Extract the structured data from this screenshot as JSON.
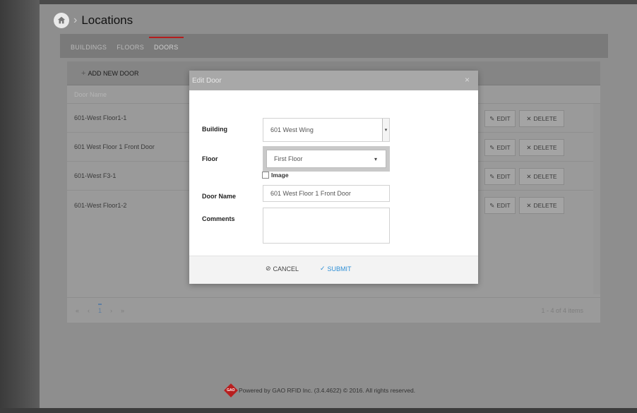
{
  "header": {
    "title": "Locations",
    "breadcrumb_sep": "›"
  },
  "tabs": [
    {
      "label": "BUILDINGS",
      "active": false
    },
    {
      "label": "FLOORS",
      "active": false
    },
    {
      "label": "DOORS",
      "active": true
    }
  ],
  "toolbar": {
    "add_label": "ADD NEW DOOR"
  },
  "table": {
    "column_header": "Door Name",
    "rows": [
      {
        "name": "601-West Floor1-1"
      },
      {
        "name": "601 West Floor 1 Front Door"
      },
      {
        "name": "601-West F3-1"
      },
      {
        "name": "601-West Floor1-2"
      }
    ],
    "edit_label": "EDIT",
    "delete_label": "DELETE"
  },
  "pager": {
    "first": "«",
    "prev": "‹",
    "current": "1",
    "next": "›",
    "last": "»",
    "info": "1 - 4 of 4 items"
  },
  "footer": {
    "logo_text": "GAO",
    "text": "Powered by GAO RFID Inc. (3.4.4622) © 2016. All rights reserved."
  },
  "modal": {
    "title": "Edit Door",
    "close": "×",
    "building_label": "Building",
    "building_value": "601 West Wing",
    "floor_label": "Floor",
    "floor_value": "First Floor",
    "image_label": "Image",
    "door_name_label": "Door Name",
    "door_name_value": "601 West Floor 1 Front Door",
    "comments_label": "Comments",
    "comments_value": "",
    "cancel_label": "CANCEL",
    "submit_label": "SUBMIT"
  },
  "colors": {
    "accent_red": "#b51e1e",
    "submit_blue": "#2e8fd6"
  }
}
